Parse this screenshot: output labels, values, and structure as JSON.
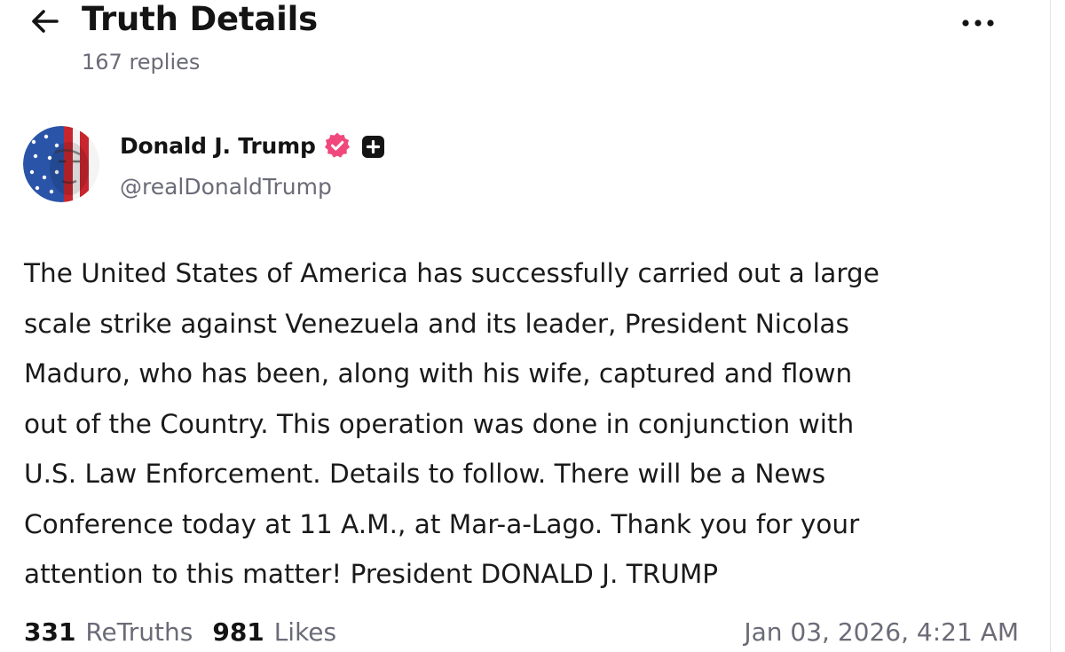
{
  "header": {
    "title": "Truth Details",
    "replies": "167 replies",
    "back_icon": "arrow-left-icon",
    "more_icon": "ellipsis-icon"
  },
  "post": {
    "author": {
      "name": "Donald J. Trump",
      "handle": "@realDonaldTrump",
      "verified_color": "#f0487c"
    },
    "text": "The United States of America has successfully carried out a large\nscale strike against Venezuela and its leader, President Nicolas\nMaduro, who has been, along with his wife, captured and flown\nout of the Country. This operation was done in conjunction with\nU.S. Law Enforcement. Details to follow. There will be a News\nConference today at 11 A.M., at Mar-a-Lago. Thank you for your\nattention to this matter! President DONALD J. TRUMP",
    "stats": {
      "retruths_count": "331",
      "retruths_label": "ReTruths",
      "likes_count": "981",
      "likes_label": "Likes"
    },
    "timestamp": "Jan 03, 2026, 4:21 AM"
  }
}
